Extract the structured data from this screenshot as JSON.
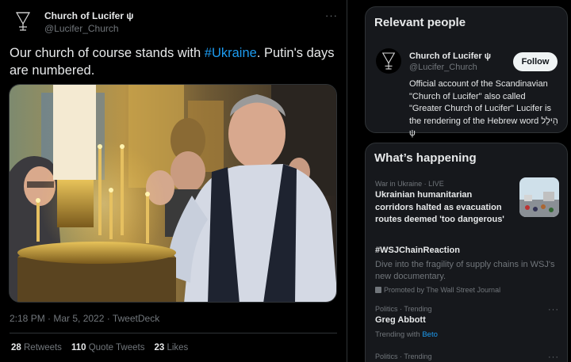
{
  "tweet": {
    "author_name": "Church of Lucifer ψ",
    "author_handle": "@Lucifer_Church",
    "more_label": "···",
    "text_before": "Our church of course stands with ",
    "hashtag": "#Ukraine",
    "text_after": ". Putin's days are numbered.",
    "timestamp": "2:18 PM · Mar 5, 2022 · TweetDeck",
    "retweets_count": "28",
    "retweets_label": "Retweets",
    "quotes_count": "110",
    "quotes_label": "Quote Tweets",
    "likes_count": "23",
    "likes_label": "Likes"
  },
  "relevant_people": {
    "title": "Relevant people",
    "name": "Church of Lucifer ψ",
    "handle": "@Lucifer_Church",
    "follow_label": "Follow",
    "bio": "Official account of the Scandinavian \"Church of Lucifer\" also called \"Greater Church of Lucifer\" Lucifer is the rendering of the Hebrew word הֵילֵל ψ"
  },
  "whats_happening": {
    "title": "What’s happening",
    "trends": [
      {
        "meta": "War in Ukraine · LIVE",
        "title": "Ukrainian humanitarian corridors halted as evacuation routes deemed 'too dangerous'"
      },
      {
        "meta": "",
        "title": "#WSJChainReaction",
        "desc": "Dive into the fragility of supply chains in WSJ's new documentary.",
        "promo": "Promoted by The Wall Street Journal"
      },
      {
        "meta": "Politics · Trending",
        "title": "Greg Abbott",
        "trending_with": "Trending with",
        "trending_link": "Beto"
      },
      {
        "meta": "Politics · Trending"
      }
    ]
  },
  "colors": {
    "accent": "#1d9bf0",
    "background": "#000000",
    "card": "#16181c",
    "muted": "#71767b"
  },
  "icons": [
    "lucifer-sigil-icon",
    "more-icon",
    "promoted-icon"
  ]
}
